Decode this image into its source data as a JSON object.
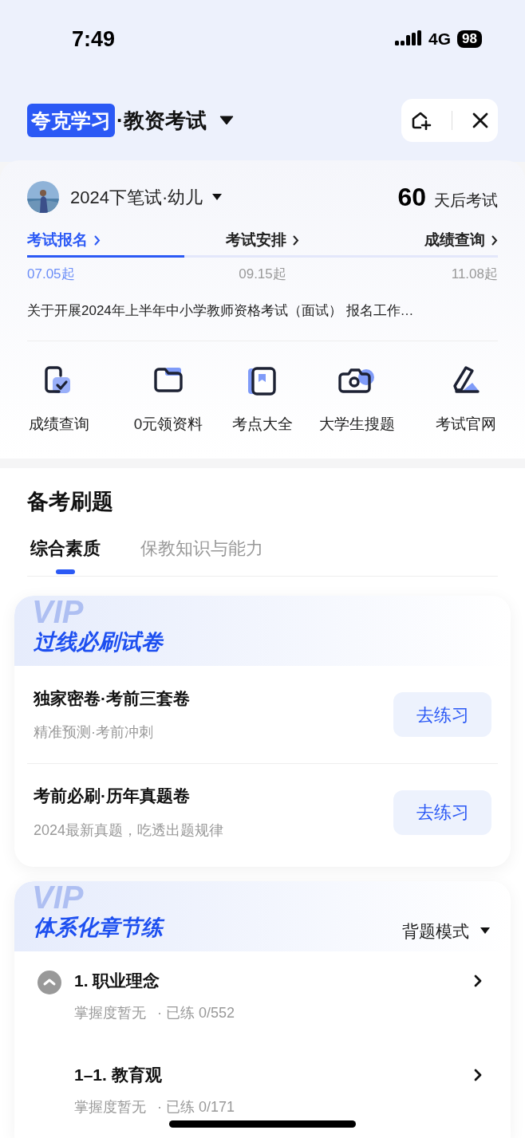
{
  "status_bar": {
    "time": "7:49",
    "network": "4G",
    "battery": "98"
  },
  "header": {
    "brand": "夸克学习",
    "title": "·教资考试"
  },
  "exam": {
    "name": "2024下笔试·幼儿",
    "countdown": "60",
    "countdown_label": "天后考试"
  },
  "steps": [
    {
      "label": "考试报名",
      "date": "07.05起",
      "selected": true
    },
    {
      "label": "考试安排",
      "date": "09.15起",
      "selected": false
    },
    {
      "label": "成绩查询",
      "date": "11.08起",
      "selected": false
    }
  ],
  "notice": "关于开展2024年上半年中小学教师资格考试（面试） 报名工作…",
  "shortcuts": [
    {
      "kind": "score",
      "label": "成绩查询"
    },
    {
      "kind": "folder",
      "label": "0元领资料"
    },
    {
      "kind": "book",
      "label": "考点大全"
    },
    {
      "kind": "camera",
      "label": "大学生搜题"
    },
    {
      "kind": "site",
      "label": "考试官网"
    }
  ],
  "practice": {
    "title": "备考刷题",
    "tabs": [
      {
        "label": "综合素质",
        "selected": true
      },
      {
        "label": "保教知识与能力",
        "selected": false
      }
    ]
  },
  "papers": {
    "watermark": "VIP",
    "title": "过线必刷试卷",
    "items": [
      {
        "title": "独家密卷·考前三套卷",
        "subtitle": "精准预测·考前冲刺",
        "button": "去练习"
      },
      {
        "title": "考前必刷·历年真题卷",
        "subtitle": "2024最新真题，吃透出题规律",
        "button": "去练习"
      }
    ]
  },
  "chapters": {
    "watermark": "VIP",
    "title": "体系化章节练",
    "mode": "背题模式",
    "items": [
      {
        "title": "1. 职业理念",
        "mastery": "掌握度暂无",
        "practiced": "· 已练 0/552",
        "expanded": true,
        "children": [
          {
            "title": "1–1. 教育观",
            "mastery": "掌握度暂无",
            "practiced": "· 已练 0/171"
          }
        ]
      }
    ]
  }
}
